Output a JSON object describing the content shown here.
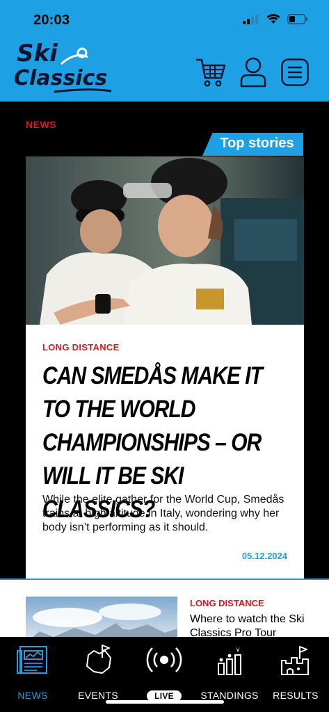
{
  "status": {
    "time": "20:03"
  },
  "header": {
    "logo_text_line1": "Ski",
    "logo_text_line2": "Classics",
    "colors": {
      "brand_blue": "#1EA0E5"
    },
    "icons": [
      "cart-icon",
      "user-icon",
      "menu-icon"
    ]
  },
  "main": {
    "section_label": "NEWS",
    "top_stories_label": "Top stories",
    "featured": {
      "category": "LONG DISTANCE",
      "title": "CAN SMEDÅS MAKE IT TO THE WORLD CHAMPIONSHIPS – OR WILL IT BE SKI CLASSICS?",
      "description": "While the elite gather for the World Cup, Smedås trains at high altitude in Italy, wondering why her body isn’t performing as it should.",
      "date": "05.12.2024"
    },
    "second": {
      "category": "LONG DISTANCE",
      "title": "Where to watch the Ski Classics Pro Tour"
    },
    "colors": {
      "category_red": "#E5141D"
    }
  },
  "tabbar": {
    "tabs": [
      {
        "label": "NEWS",
        "icon": "newspaper-icon",
        "active": true
      },
      {
        "label": "EVENTS",
        "icon": "map-flag-icon",
        "active": false
      },
      {
        "label": "LIVE",
        "icon": "broadcast-icon",
        "active": false
      },
      {
        "label": "STANDINGS",
        "icon": "podium-icon",
        "active": false
      },
      {
        "label": "RESULTS",
        "icon": "castle-flag-icon",
        "active": false
      }
    ]
  }
}
